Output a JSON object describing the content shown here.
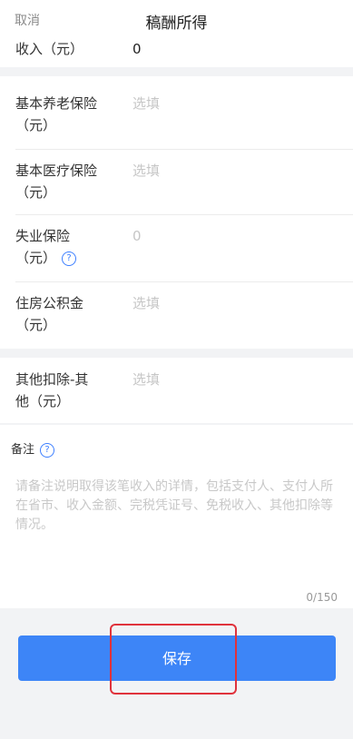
{
  "header": {
    "cancel_label": "取消",
    "title": "稿酬所得"
  },
  "income": {
    "label": "收入（元）",
    "value": "0"
  },
  "deductions": [
    {
      "label_line1": "基本养老保险",
      "label_line2": "（元）",
      "value": "选填",
      "filled": false
    },
    {
      "label_line1": "基本医疗保险",
      "label_line2": "（元）",
      "value": "选填",
      "filled": false
    },
    {
      "label_line1": "失业保险",
      "label_line2": "（元）",
      "value": "0",
      "filled": false,
      "help": true
    },
    {
      "label_line1": "住房公积金",
      "label_line2": "（元）",
      "value": "选填",
      "filled": false
    }
  ],
  "other_deduction": {
    "label_line1": "其他扣除-其",
    "label_line2": "他（元）",
    "value": "选填"
  },
  "notes": {
    "label": "备注",
    "placeholder": "请备注说明取得该笔收入的详情，包括支付人、支付人所在省市、收入金额、完税凭证号、免税收入、其他扣除等情况。",
    "counter": "0/150"
  },
  "save_label": "保存",
  "colors": {
    "accent": "#3d85f7",
    "highlight_border": "#e0323c",
    "help_icon": "#3d7fff"
  },
  "icons": {
    "help": "question-circle-icon"
  }
}
